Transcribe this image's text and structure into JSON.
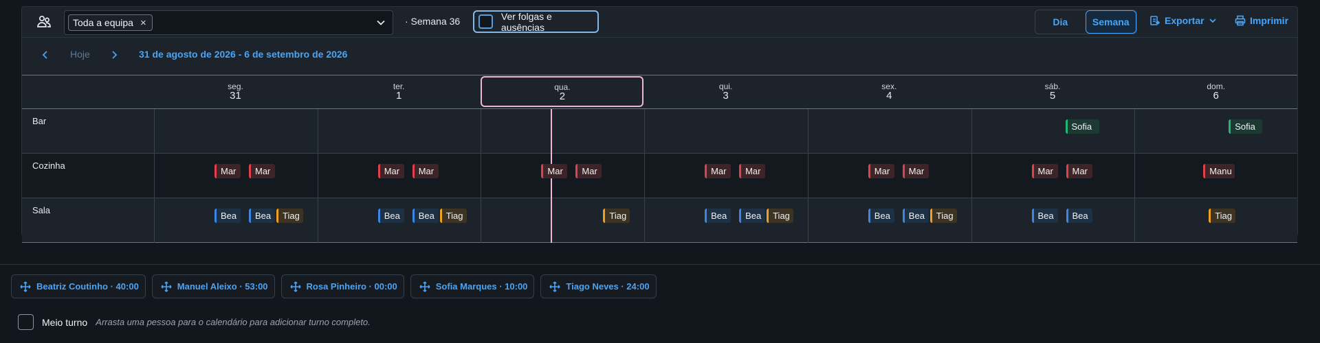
{
  "toolbar": {
    "team_icon": "team-icon",
    "team_token": "Toda a equipa",
    "token_remove": "×",
    "week_label": "· Semana 36",
    "folgas_label": "Ver folgas e ausências",
    "view_day": "Dia",
    "view_week": "Semana",
    "export_label": "Exportar",
    "print_label": "Imprimir",
    "accent": "#4aa4f5"
  },
  "nav": {
    "today_label": "Hoje",
    "range_label": "31 de agosto de 2026 - 6 de setembro de 2026"
  },
  "days": [
    {
      "name": "seg.",
      "num": "31"
    },
    {
      "name": "ter.",
      "num": "1"
    },
    {
      "name": "qua.",
      "num": "2",
      "today": true
    },
    {
      "name": "qui.",
      "num": "3"
    },
    {
      "name": "sex.",
      "num": "4"
    },
    {
      "name": "sáb.",
      "num": "5"
    },
    {
      "name": "dom.",
      "num": "6"
    }
  ],
  "rows": [
    {
      "label": "Bar"
    },
    {
      "label": "Cozinha"
    },
    {
      "label": "Sala"
    }
  ],
  "shifts": {
    "bar": [
      {
        "day": 5,
        "text": "Sofia",
        "color": "green"
      },
      {
        "day": 6,
        "text": "Sofia",
        "color": "green"
      }
    ],
    "cozinha": [
      {
        "day": 0,
        "text": "Mar",
        "color": "red"
      },
      {
        "day": 0,
        "text": "Mar",
        "color": "red"
      },
      {
        "day": 1,
        "text": "Mar",
        "color": "red"
      },
      {
        "day": 1,
        "text": "Mar",
        "color": "red"
      },
      {
        "day": 2,
        "text": "Mar",
        "color": "red"
      },
      {
        "day": 2,
        "text": "Mar",
        "color": "red"
      },
      {
        "day": 3,
        "text": "Mar",
        "color": "red"
      },
      {
        "day": 3,
        "text": "Mar",
        "color": "red"
      },
      {
        "day": 4,
        "text": "Mar",
        "color": "red"
      },
      {
        "day": 4,
        "text": "Mar",
        "color": "red"
      },
      {
        "day": 5,
        "text": "Mar",
        "color": "red"
      },
      {
        "day": 5,
        "text": "Mar",
        "color": "red"
      },
      {
        "day": 6,
        "text": "Manu",
        "color": "red"
      }
    ],
    "sala": [
      {
        "day": 0,
        "text": "Bea",
        "color": "blue"
      },
      {
        "day": 0,
        "text": "Bea",
        "color": "blue"
      },
      {
        "day": 0,
        "text": "Tiag",
        "color": "orange"
      },
      {
        "day": 1,
        "text": "Bea",
        "color": "blue"
      },
      {
        "day": 1,
        "text": "Bea",
        "color": "blue"
      },
      {
        "day": 1,
        "text": "Tiag",
        "color": "orange"
      },
      {
        "day": 2,
        "text": "Tiag",
        "color": "orange"
      },
      {
        "day": 3,
        "text": "Bea",
        "color": "blue"
      },
      {
        "day": 3,
        "text": "Bea",
        "color": "blue"
      },
      {
        "day": 3,
        "text": "Tiag",
        "color": "orange"
      },
      {
        "day": 4,
        "text": "Bea",
        "color": "blue"
      },
      {
        "day": 4,
        "text": "Bea",
        "color": "blue"
      },
      {
        "day": 4,
        "text": "Tiag",
        "color": "orange"
      },
      {
        "day": 5,
        "text": "Bea",
        "color": "blue"
      },
      {
        "day": 5,
        "text": "Bea",
        "color": "blue"
      },
      {
        "day": 6,
        "text": "Tiag",
        "color": "orange"
      }
    ]
  },
  "shift_colors": {
    "red": "#e0414a",
    "blue": "#3d86e3",
    "orange": "#f0a020",
    "green": "#22b573"
  },
  "people": [
    {
      "label": "Beatriz Coutinho · 40:00"
    },
    {
      "label": "Manuel Aleixo · 53:00"
    },
    {
      "label": "Rosa Pinheiro · 00:00"
    },
    {
      "label": "Sofia Marques · 10:00"
    },
    {
      "label": "Tiago Neves · 24:00"
    }
  ],
  "meio_turno": {
    "label": "Meio turno",
    "hint": "Arrasta uma pessoa para o calendário para adicionar turno completo."
  }
}
